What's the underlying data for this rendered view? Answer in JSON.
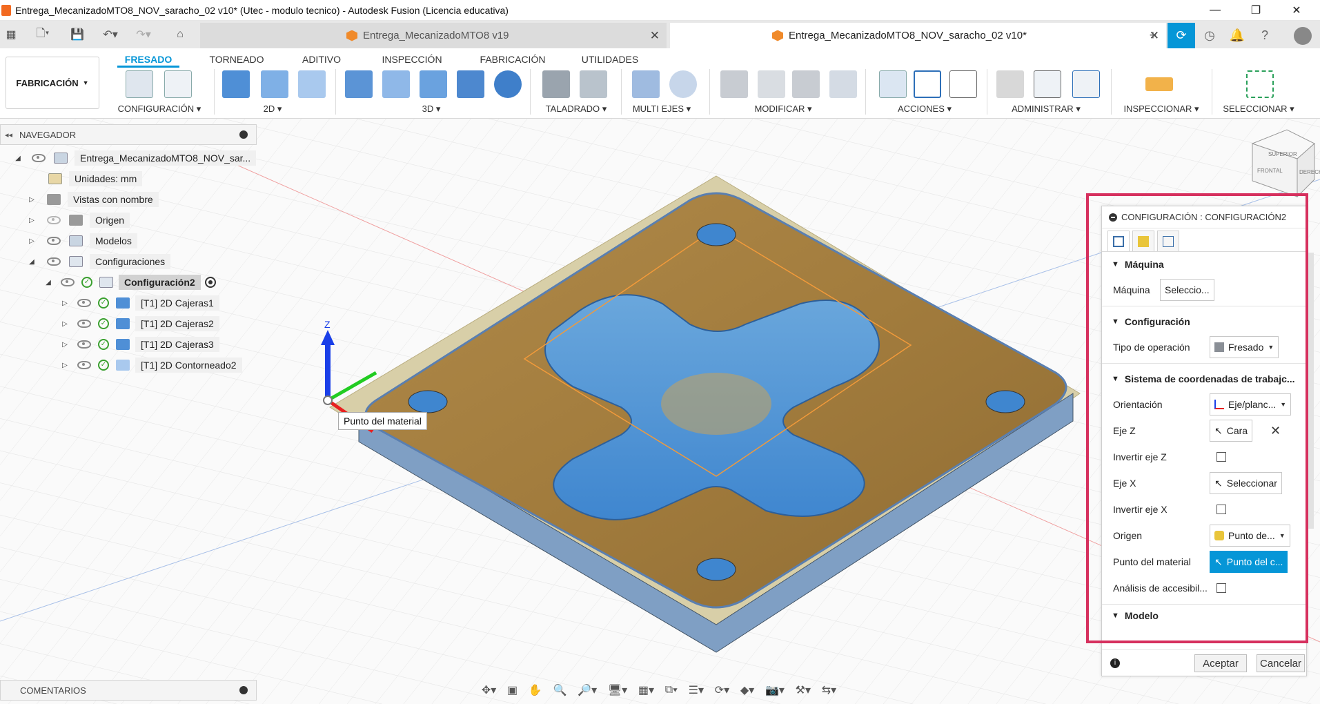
{
  "window": {
    "title": "Entrega_MecanizadoMTO8_NOV_saracho_02 v10* (Utec - modulo tecnico) - Autodesk Fusion (Licencia educativa)",
    "controls": [
      "—",
      "❐",
      "✕"
    ]
  },
  "tabs": {
    "inactive": "Entrega_MecanizadoMTO8 v19",
    "active": "Entrega_MecanizadoMTO8_NOV_saracho_02 v10*",
    "close": "✕",
    "add": "+"
  },
  "ribbon": {
    "workspace": "FABRICACIÓN",
    "tabs": [
      "FRESADO",
      "TORNEADO",
      "ADITIVO",
      "INSPECCIÓN",
      "FABRICACIÓN",
      "UTILIDADES"
    ],
    "groups": [
      "CONFIGURACIÓN",
      "2D",
      "3D",
      "TALADRADO",
      "MULTI EJES",
      "MODIFICAR",
      "ACCIONES",
      "ADMINISTRAR",
      "INSPECCIONAR",
      "SELECCIONAR"
    ],
    "accent": "#0696d7"
  },
  "navigator": {
    "header": "NAVEGADOR",
    "items": [
      {
        "label": "Entrega_MecanizadoMTO8_NOV_sar..."
      },
      {
        "label": "Unidades: mm"
      },
      {
        "label": "Vistas con nombre"
      },
      {
        "label": "Origen"
      },
      {
        "label": "Modelos"
      },
      {
        "label": "Configuraciones"
      },
      {
        "label": "Configuración2"
      },
      {
        "label": "[T1] 2D Cajeras1"
      },
      {
        "label": "[T1] 2D Cajeras2"
      },
      {
        "label": "[T1] 2D Cajeras3"
      },
      {
        "label": "[T1] 2D Contorneado2"
      }
    ]
  },
  "viewport": {
    "tooltip": "Punto del material",
    "axis_z": "Z"
  },
  "viewcube": {
    "top": "SUPERIOR",
    "front": "FRONTAL",
    "right": "DERECHA"
  },
  "comments": {
    "header": "COMENTARIOS"
  },
  "panel": {
    "title": "CONFIGURACIÓN : CONFIGURACIÓN2",
    "sections": {
      "machine": "Máquina",
      "setup": "Configuración",
      "wcs": "Sistema de coordenadas de trabajc...",
      "model": "Modelo"
    },
    "rows": {
      "machine_label": "Máquina",
      "machine_value": "Seleccio...",
      "op_type_label": "Tipo de operación",
      "op_type_value": "Fresado",
      "orientation_label": "Orientación",
      "orientation_value": "Eje/planc...",
      "zaxis_label": "Eje Z",
      "zaxis_value": "Cara",
      "invert_z_label": "Invertir eje Z",
      "xaxis_label": "Eje X",
      "xaxis_value": "Seleccionar",
      "invert_x_label": "Invertir eje X",
      "origin_label": "Origen",
      "origin_value": "Punto de...",
      "stock_point_label": "Punto del material",
      "stock_point_value": "Punto del c...",
      "accessibility_label": "Análisis de accesibil..."
    },
    "ok": "Aceptar",
    "cancel": "Cancelar",
    "highlight_color": "#d6305e"
  }
}
